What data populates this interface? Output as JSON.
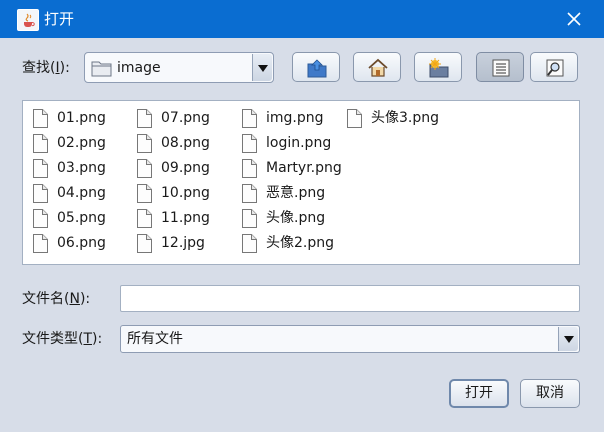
{
  "window": {
    "title": "打开",
    "app_icon": "java-cup-icon",
    "close_icon": "close-icon"
  },
  "lookin": {
    "label_prefix": "查找(",
    "label_mnemonic": "I",
    "label_suffix": "):",
    "value": "image",
    "folder_icon": "folder-icon"
  },
  "toolbar": [
    {
      "name": "up-one-level-button",
      "icon": "up-folder-icon"
    },
    {
      "name": "home-button",
      "icon": "home-icon"
    },
    {
      "name": "new-folder-button",
      "icon": "new-folder-icon"
    },
    {
      "name": "list-view-button",
      "icon": "list-view-icon",
      "active": true
    },
    {
      "name": "details-view-button",
      "icon": "details-view-icon"
    }
  ],
  "files": {
    "columns": [
      [
        "01.png",
        "02.png",
        "03.png",
        "04.png",
        "05.png",
        "06.png"
      ],
      [
        "07.png",
        "08.png",
        "09.png",
        "10.png",
        "11.png",
        "12.jpg"
      ],
      [
        "img.png",
        "login.png",
        "Martyr.png",
        "恶意.png",
        "头像.png",
        "头像2.png"
      ],
      [
        "头像3.png"
      ]
    ],
    "icon": "file-icon"
  },
  "filename": {
    "label_prefix": "文件名(",
    "label_mnemonic": "N",
    "label_suffix": "):",
    "value": ""
  },
  "filetype": {
    "label_prefix": "文件类型(",
    "label_mnemonic": "T",
    "label_suffix": "):",
    "value": "所有文件"
  },
  "buttons": {
    "open": "打开",
    "cancel": "取消"
  },
  "colors": {
    "titlebar": "#0a6dd1",
    "background": "#d7dde8"
  }
}
